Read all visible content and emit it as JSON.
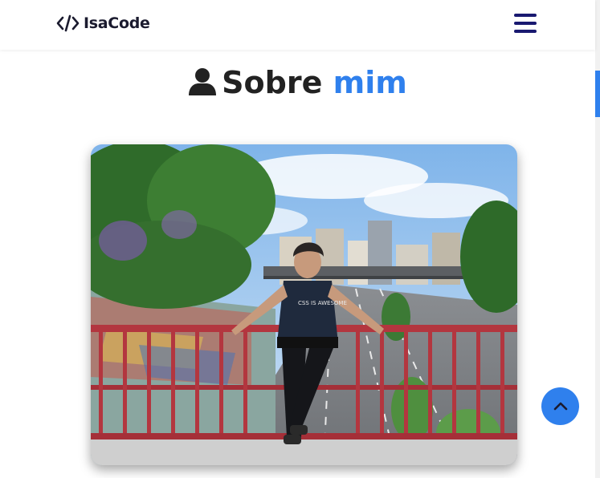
{
  "header": {
    "logo_text": "IsaCode",
    "logo_icon": "code-icon",
    "menu_icon": "hamburger-menu-icon"
  },
  "about": {
    "title_part1": "Sobre",
    "title_part2": "mim",
    "title_icon": "user-icon",
    "photo_alt": "Foto de perfil",
    "shirt_text": "CSS IS AWESOME"
  },
  "back_to_top": {
    "icon": "chevron-up-icon"
  },
  "colors": {
    "accent": "#2f80ed",
    "dark": "#1b1b2f",
    "menu": "#191970"
  }
}
